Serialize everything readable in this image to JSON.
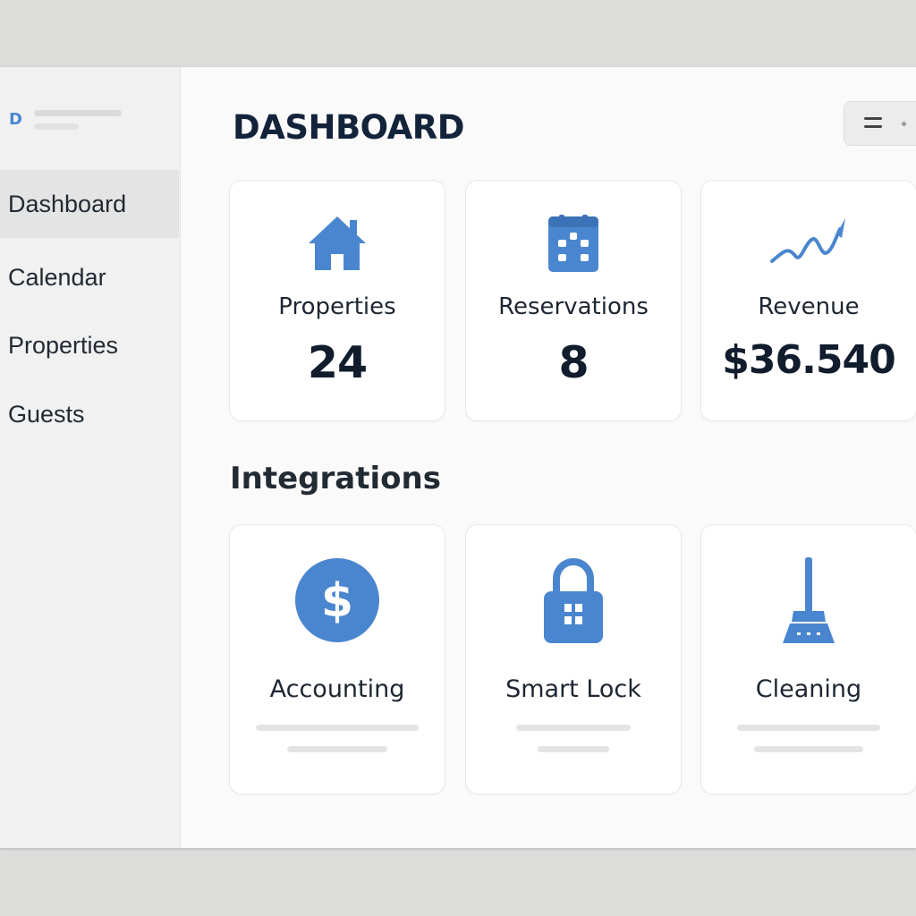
{
  "app": {
    "logo_letter": "D"
  },
  "sidebar": {
    "items": [
      {
        "label": "Dashboard",
        "active": true
      },
      {
        "label": "Calendar",
        "active": false
      },
      {
        "label": "Properties",
        "active": false
      },
      {
        "label": "Guests",
        "active": false
      }
    ]
  },
  "header": {
    "title": "DASHBOARD",
    "menu_icon": "menu-icon"
  },
  "stats": [
    {
      "label": "Properties",
      "value": "24",
      "icon": "house-icon"
    },
    {
      "label": "Reservations",
      "value": "8",
      "icon": "calendar-icon"
    },
    {
      "label": "Revenue",
      "value": "$36.540",
      "icon": "trend-line-icon"
    }
  ],
  "integrations": {
    "title": "Integrations",
    "items": [
      {
        "label": "Accounting",
        "icon": "dollar-icon"
      },
      {
        "label": "Smart Lock",
        "icon": "padlock-icon"
      },
      {
        "label": "Cleaning",
        "icon": "broom-icon"
      }
    ]
  },
  "colors": {
    "accent": "#4a86cf",
    "text_dark": "#13233a",
    "sidebar_bg": "#f1f1f1",
    "sidebar_active": "#e4e4e4",
    "card_bg": "#ffffff"
  }
}
